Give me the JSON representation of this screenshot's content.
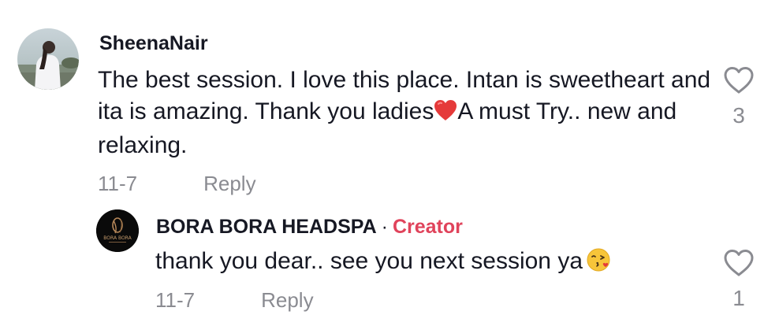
{
  "comment": {
    "username": "SheenaNair",
    "text_part1": "The best session. I love this place. Intan is sweetheart and ita is amazing. Thank you ladies",
    "emoji": "red-heart",
    "text_part2": "A must Try.. new and relaxing.",
    "date": "11-7",
    "reply_label": "Reply",
    "like_count": "3",
    "avatar_icon": "profile-photo"
  },
  "reply": {
    "username": "BORA BORA HEADSPA",
    "separator": "·",
    "badge": "Creator",
    "text": "thank you dear.. see you next session ya",
    "emoji": "face-blowing-a-kiss",
    "date": "11-7",
    "reply_label": "Reply",
    "like_count": "1",
    "avatar_logo_text": "BORA BORA"
  },
  "colors": {
    "text": "#161823",
    "meta": "#8a8b91",
    "creator": "#e0435b",
    "heart_outline": "#8a8b91"
  }
}
